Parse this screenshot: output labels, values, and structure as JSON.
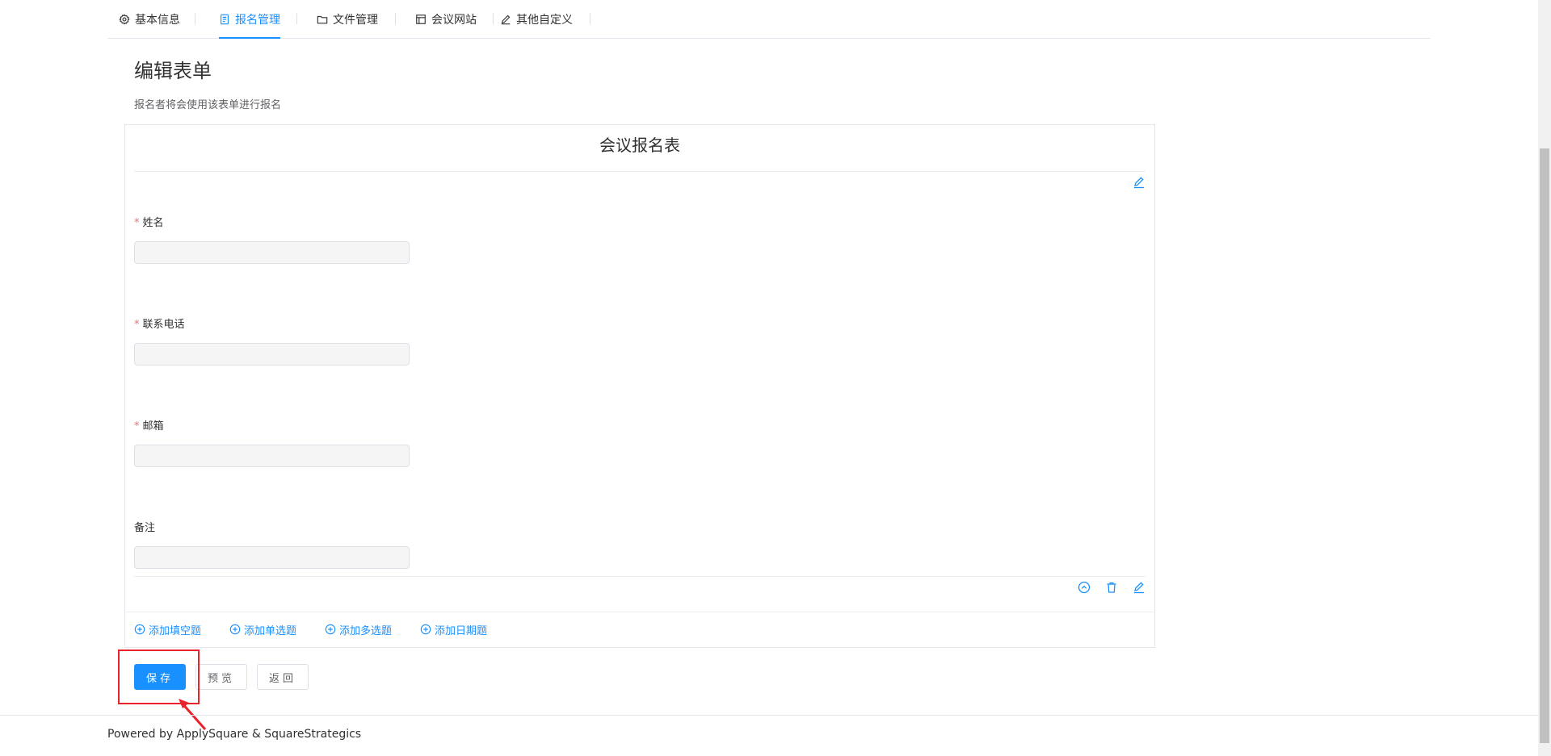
{
  "tabs": [
    {
      "label": "基本信息",
      "icon": "gear-icon"
    },
    {
      "label": "报名管理",
      "icon": "document-icon"
    },
    {
      "label": "文件管理",
      "icon": "folder-icon"
    },
    {
      "label": "会议网站",
      "icon": "layout-icon"
    },
    {
      "label": "其他自定义",
      "icon": "pencil-icon"
    }
  ],
  "page": {
    "title": "编辑表单",
    "subtitle": "报名者将会使用该表单进行报名"
  },
  "form": {
    "title": "会议报名表",
    "fields": [
      {
        "label": "姓名",
        "required": true,
        "value": ""
      },
      {
        "label": "联系电话",
        "required": true,
        "value": ""
      },
      {
        "label": "邮箱",
        "required": true,
        "value": ""
      },
      {
        "label": "备注",
        "required": false,
        "value": ""
      }
    ],
    "required_mark": "*"
  },
  "add_links": [
    {
      "label": "添加填空题"
    },
    {
      "label": "添加单选题"
    },
    {
      "label": "添加多选题"
    },
    {
      "label": "添加日期题"
    }
  ],
  "buttons": {
    "save": "保存",
    "preview": "预览",
    "back": "返回"
  },
  "footer": {
    "text": "Powered by ApplySquare & SquareStrategics"
  },
  "colors": {
    "accent": "#1890ff",
    "required": "#f56c6c",
    "annotation": "#e8232b"
  }
}
